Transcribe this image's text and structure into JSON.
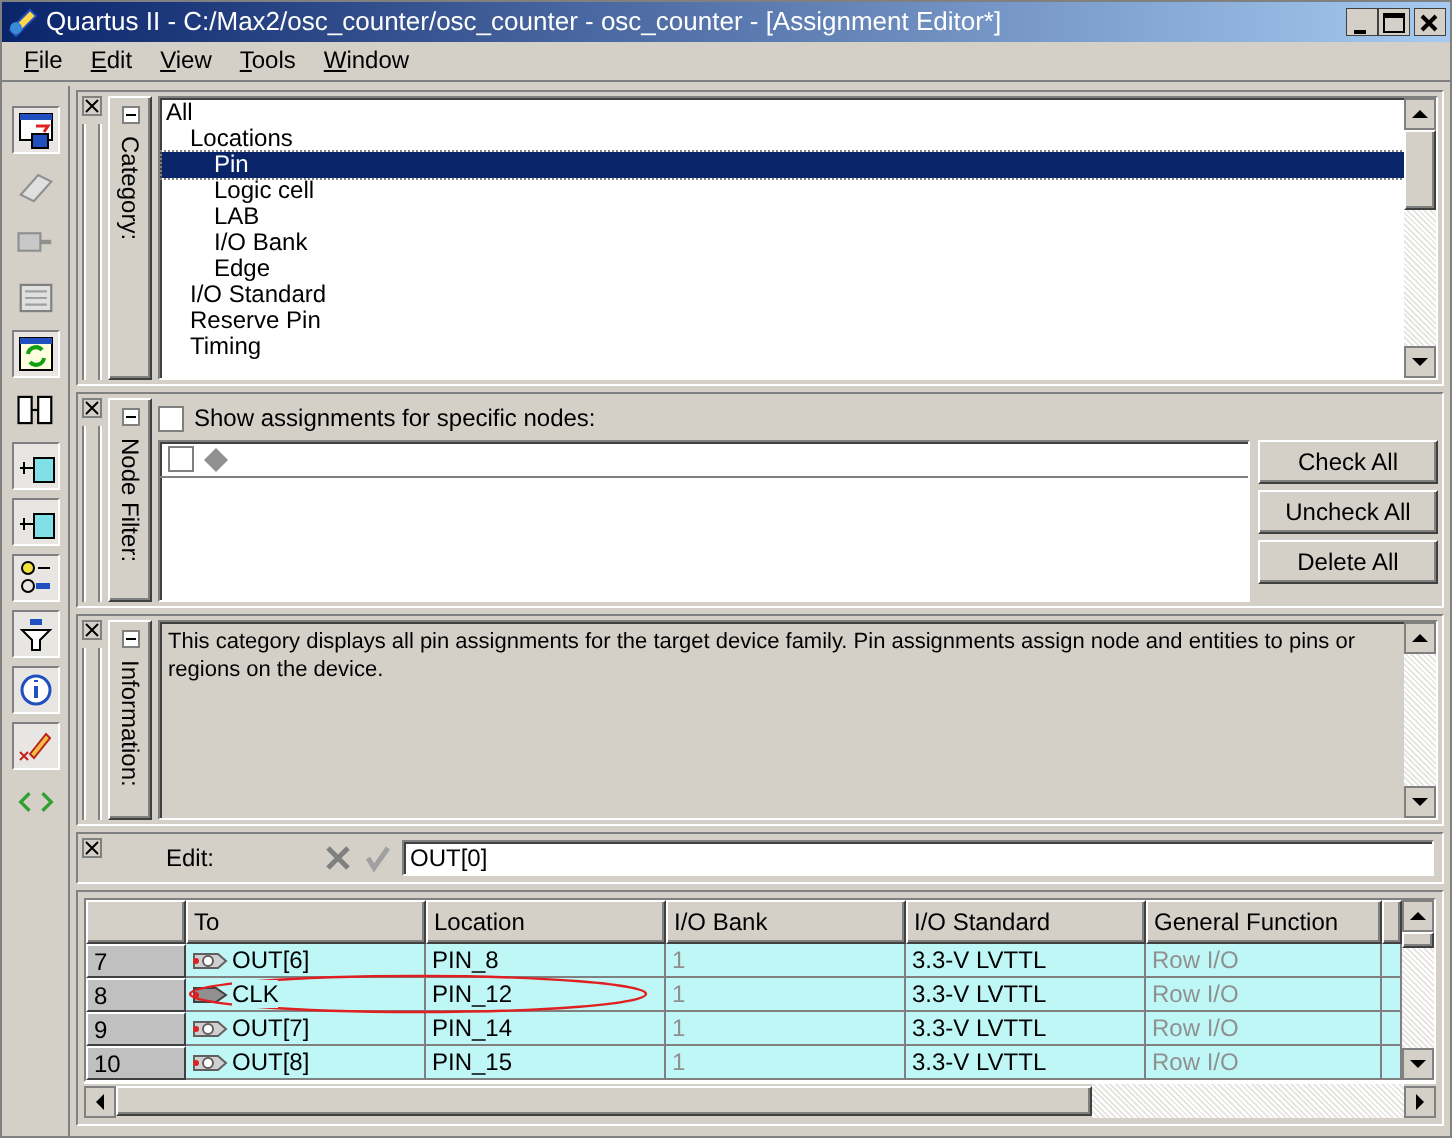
{
  "window": {
    "title": "Quartus II - C:/Max2/osc_counter/osc_counter - osc_counter - [Assignment Editor*]"
  },
  "menu": [
    {
      "label": "File"
    },
    {
      "label": "Edit"
    },
    {
      "label": "View"
    },
    {
      "label": "Tools"
    },
    {
      "label": "Window"
    }
  ],
  "category_panel": {
    "label": "Category:",
    "expanded": true,
    "tree": [
      {
        "label": "All",
        "selected": false,
        "children": [
          {
            "label": "Locations",
            "selected": false,
            "children": [
              {
                "label": "Pin",
                "selected": true
              },
              {
                "label": "Logic cell",
                "selected": false
              },
              {
                "label": "LAB",
                "selected": false
              },
              {
                "label": "I/O Bank",
                "selected": false
              },
              {
                "label": "Edge",
                "selected": false
              }
            ]
          },
          {
            "label": "I/O Standard",
            "selected": false
          },
          {
            "label": "Reserve Pin",
            "selected": false
          },
          {
            "label": "Timing",
            "selected": false
          }
        ]
      }
    ]
  },
  "node_filter_panel": {
    "label": "Node Filter:",
    "expanded": true,
    "show_specific": {
      "label": "Show assignments for specific nodes:",
      "checked": false
    },
    "nodes": [
      {
        "checked": false
      }
    ],
    "buttons": [
      "Check All",
      "Uncheck All",
      "Delete All"
    ]
  },
  "information_panel": {
    "label": "Information:",
    "expanded": true,
    "text": "This category displays all pin assignments for the target device family. Pin assignments assign node and entities to pins or regions on the device."
  },
  "edit_bar": {
    "label": "Edit:",
    "value": "OUT[0]"
  },
  "table": {
    "columns": [
      {
        "label": "To",
        "dimmed": false
      },
      {
        "label": "Location",
        "dimmed": false
      },
      {
        "label": "I/O Bank",
        "dimmed": true
      },
      {
        "label": "I/O Standard",
        "dimmed": false
      },
      {
        "label": "General Function",
        "dimmed": true
      }
    ],
    "rows": [
      {
        "number": "7",
        "kind": "output",
        "cells": [
          "OUT[6]",
          "PIN_8",
          "1",
          "3.3-V LVTTL",
          "Row I/O"
        ],
        "circled": false
      },
      {
        "number": "8",
        "kind": "input",
        "cells": [
          "CLK",
          "PIN_12",
          "1",
          "3.3-V LVTTL",
          "Row I/O"
        ],
        "circled": true
      },
      {
        "number": "9",
        "kind": "output",
        "cells": [
          "OUT[7]",
          "PIN_14",
          "1",
          "3.3-V LVTTL",
          "Row I/O"
        ],
        "circled": false
      },
      {
        "number": "10",
        "kind": "output",
        "cells": [
          "OUT[8]",
          "PIN_15",
          "1",
          "3.3-V LVTTL",
          "Row I/O"
        ],
        "circled": false
      }
    ]
  }
}
